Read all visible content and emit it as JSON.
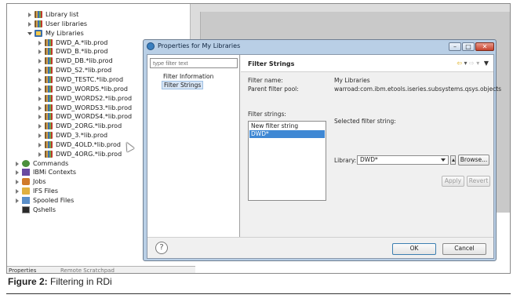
{
  "tree": {
    "items": [
      {
        "label": "Library list",
        "icon": "library-list-icon",
        "state": "closed",
        "level": 1
      },
      {
        "label": "User libraries",
        "icon": "user-libraries-icon",
        "state": "closed",
        "level": 1
      },
      {
        "label": "My Libraries",
        "icon": "filter-icon",
        "state": "open",
        "level": 1
      },
      {
        "label": "DWD_A.*lib.prod",
        "icon": "library-icon",
        "state": "closed",
        "level": 2
      },
      {
        "label": "DWD_B.*lib.prod",
        "icon": "library-icon",
        "state": "closed",
        "level": 2
      },
      {
        "label": "DWD_DB.*lib.prod",
        "icon": "library-icon",
        "state": "closed",
        "level": 2
      },
      {
        "label": "DWD_S2.*lib.prod",
        "icon": "library-icon",
        "state": "closed",
        "level": 2
      },
      {
        "label": "DWD_TESTC.*lib.prod",
        "icon": "library-icon",
        "state": "closed",
        "level": 2
      },
      {
        "label": "DWD_WORDS.*lib.prod",
        "icon": "library-icon",
        "state": "closed",
        "level": 2
      },
      {
        "label": "DWD_WORDS2.*lib.prod",
        "icon": "library-icon",
        "state": "closed",
        "level": 2
      },
      {
        "label": "DWD_WORDS3.*lib.prod",
        "icon": "library-icon",
        "state": "closed",
        "level": 2
      },
      {
        "label": "DWD_WORDS4.*lib.prod",
        "icon": "library-icon",
        "state": "closed",
        "level": 2
      },
      {
        "label": "DWD_2ORG.*lib.prod",
        "icon": "library-icon",
        "state": "closed",
        "level": 2
      },
      {
        "label": "DWD_3.*lib.prod",
        "icon": "library-icon",
        "state": "closed",
        "level": 2
      },
      {
        "label": "DWD_4OLD.*lib.prod",
        "icon": "library-icon",
        "state": "closed",
        "level": 2
      },
      {
        "label": "DWD_4ORG.*lib.prod",
        "icon": "library-icon",
        "state": "closed",
        "level": 2
      },
      {
        "label": "Commands",
        "icon": "commands-icon",
        "state": "closed",
        "level": 0
      },
      {
        "label": "IBMi Contexts",
        "icon": "contexts-icon",
        "state": "closed",
        "level": 0
      },
      {
        "label": "Jobs",
        "icon": "jobs-icon",
        "state": "closed",
        "level": 0
      },
      {
        "label": "IFS Files",
        "icon": "ifs-files-icon",
        "state": "closed",
        "level": 0
      },
      {
        "label": "Spooled Files",
        "icon": "spooled-files-icon",
        "state": "closed",
        "level": 0
      },
      {
        "label": "Qshells",
        "icon": "qshells-icon",
        "state": "none",
        "level": 0
      }
    ]
  },
  "bottom_tabs": {
    "properties": "Properties",
    "remote_scratchpad": "Remote Scratchpad"
  },
  "dialog": {
    "title": "Properties for My Libraries",
    "window_buttons": {
      "minimize": "–",
      "maximize": "□",
      "close": "✕"
    },
    "nav": {
      "filter_placeholder": "type filter text",
      "items": [
        "Filter Information",
        "Filter Strings"
      ],
      "selected": "Filter Strings"
    },
    "page": {
      "title": "Filter Strings",
      "filter_name_label": "Filter name:",
      "filter_name_value": "My Libraries",
      "parent_pool_label": "Parent filter pool:",
      "parent_pool_value": "warroad:com.ibm.etools.iseries.subsystems.qsys.objects",
      "filter_strings_label": "Filter strings:",
      "filter_strings": [
        "New filter string",
        "DWD*"
      ],
      "selected_filter_string": "DWD*",
      "selected_label": "Selected filter string:",
      "library_label": "Library:",
      "library_value": "DWD*",
      "browse_label": "Browse...",
      "apply_label": "Apply",
      "revert_label": "Revert"
    },
    "help_glyph": "?",
    "ok_label": "OK",
    "cancel_label": "Cancel"
  },
  "caption": {
    "figure": "Figure 2:",
    "text": "Filtering in RDi"
  }
}
